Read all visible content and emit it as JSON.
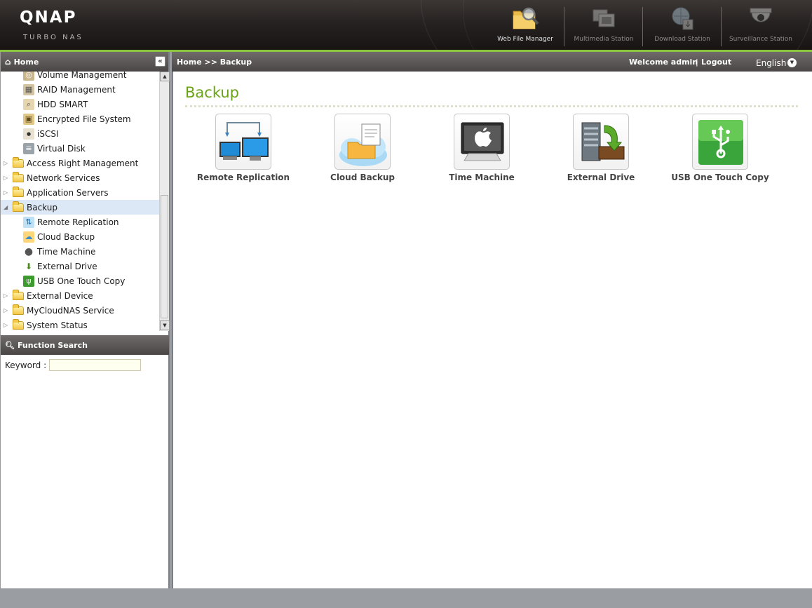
{
  "header": {
    "logo": "QNAP",
    "logo_sub": "Turbo NAS",
    "apps": [
      {
        "label": "Web File Manager",
        "icon": "folder-magnifier-icon"
      },
      {
        "label": "Multimedia Station",
        "icon": "multimedia-icon"
      },
      {
        "label": "Download Station",
        "icon": "download-globe-icon"
      },
      {
        "label": "Surveillance Station",
        "icon": "camera-dome-icon"
      }
    ]
  },
  "sidebar": {
    "title": "Home",
    "tree": [
      {
        "label": "Volume Management",
        "icon": "volume-icon"
      },
      {
        "label": "RAID Management",
        "icon": "raid-icon"
      },
      {
        "label": "HDD SMART",
        "icon": "hdd-smart-icon"
      },
      {
        "label": "Encrypted File System",
        "icon": "lock-icon"
      },
      {
        "label": "iSCSI",
        "icon": "iscsi-icon"
      },
      {
        "label": "Virtual Disk",
        "icon": "virtual-disk-icon"
      },
      {
        "label": "Access Right Management",
        "icon": "folder-icon"
      },
      {
        "label": "Network Services",
        "icon": "folder-icon"
      },
      {
        "label": "Application Servers",
        "icon": "folder-icon"
      },
      {
        "label": "Backup",
        "icon": "folder-open-icon"
      },
      {
        "label": "Remote Replication",
        "icon": "remote-replication-icon"
      },
      {
        "label": "Cloud Backup",
        "icon": "cloud-backup-icon"
      },
      {
        "label": "Time Machine",
        "icon": "apple-icon"
      },
      {
        "label": "External Drive",
        "icon": "external-drive-icon"
      },
      {
        "label": "USB One Touch Copy",
        "icon": "usb-icon"
      },
      {
        "label": "External Device",
        "icon": "folder-icon"
      },
      {
        "label": "MyCloudNAS Service",
        "icon": "folder-icon"
      },
      {
        "label": "System Status",
        "icon": "folder-icon"
      }
    ],
    "search": {
      "title": "Function Search",
      "keyword_label": "Keyword :",
      "keyword_value": ""
    }
  },
  "topbar": {
    "breadcrumb": "Home >> Backup",
    "welcome": "Welcome admin",
    "separator": "|",
    "logout": "Logout",
    "language": "English"
  },
  "main": {
    "title": "Backup",
    "tiles": [
      {
        "label": "Remote Replication",
        "icon": "remote-replication-icon"
      },
      {
        "label": "Cloud Backup",
        "icon": "cloud-backup-icon"
      },
      {
        "label": "Time Machine",
        "icon": "time-machine-icon"
      },
      {
        "label": "External Drive",
        "icon": "external-drive-icon"
      },
      {
        "label": "USB One Touch Copy",
        "icon": "usb-icon"
      }
    ]
  },
  "colors": {
    "accent_green": "#8bc53f",
    "title_green": "#6aa315",
    "selected_row": "#dde8f7"
  }
}
